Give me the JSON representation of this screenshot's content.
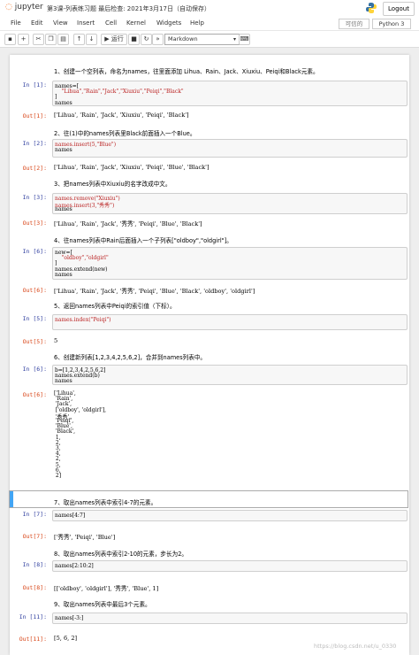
{
  "header": {
    "logo_text": "jupyter",
    "notebook_title": "第3课-列表练习题 最后检查: 2021年3月17日（自动保存）",
    "logout_label": "Logout"
  },
  "menubar": {
    "items": [
      "File",
      "Edit",
      "View",
      "Insert",
      "Cell",
      "Kernel",
      "Widgets",
      "Help"
    ],
    "trusted_label": "可信的",
    "kernel_label": "Python 3"
  },
  "toolbar": {
    "run_label": "▶ 运行",
    "cell_type": "Markdown"
  },
  "cells": [
    {
      "md": "1、创建一个空列表，命名为names，往里面添加 Lihua、Rain、Jack、Xiuxiu、Peiqi和Black元素。",
      "in_prompt": "In  [1]:",
      "code": [
        "names=[",
        "    \"Lihua\",\"Rain\",\"Jack\",\"Xiuxiu\",\"Peiqi\",\"Black\"",
        "]",
        "names"
      ],
      "out_prompt": "Out[1]:",
      "output": [
        "['Lihua', 'Rain', 'Jack', 'Xiuxiu', 'Peiqi', 'Black']"
      ]
    },
    {
      "md": "2、往(1)中的names列表里Black前面插入一个Blue。",
      "in_prompt": "In  [2]:",
      "code": [
        "names.insert(5,\"Blue\")",
        "names"
      ],
      "out_prompt": "Out[2]:",
      "output": [
        "['Lihua', 'Rain', 'Jack', 'Xiuxiu', 'Peiqi', 'Blue', 'Black']"
      ]
    },
    {
      "md": "3、把names列表中Xiuxiu的名字改成中文。",
      "in_prompt": "In  [3]:",
      "code": [
        "names.remove(\"Xiuxiu\")",
        "names.insert(3,\"秀秀\")",
        "names"
      ],
      "out_prompt": "Out[3]:",
      "output": [
        "['Lihua', 'Rain', 'Jack', '秀秀', 'Peiqi', 'Blue', 'Black']"
      ]
    },
    {
      "md": "4、往names列表中Rain后面插入一个子列表[\"oldboy\",\"oldgirl\"]。",
      "in_prompt": "In  [6]:",
      "code": [
        "new=[",
        "    \"oldboy\",\"oldgirl\"",
        "]",
        "names.extend(new)",
        "names"
      ],
      "out_prompt": "Out[6]:",
      "output": [
        "['Lihua', 'Rain', 'Jack', '秀秀', 'Peiqi', 'Blue', 'Black', 'oldboy', 'oldgirl']"
      ]
    },
    {
      "md": "5、返回names列表中Peiqi的索引值（下标）。",
      "in_prompt": "In  [5]:",
      "code": [
        "names.index(\"Peiqi\")"
      ],
      "out_prompt": "Out[5]:",
      "output": [
        "5"
      ]
    },
    {
      "md": "6、创建新列表[1,2,3,4,2,5,6,2]，合并到names列表中。",
      "in_prompt": "In  [6]:",
      "code": [
        "b=[1,2,3,4,2,5,6,2]",
        "names.extend(b)",
        "names"
      ],
      "out_prompt": "Out[6]:",
      "output": [
        "['Lihua',",
        " 'Rain',",
        " 'Jack',",
        " ['oldboy', 'oldgirl'],",
        " '秀秀',",
        " 'Peiqi',",
        " 'Blue',",
        " 'Black',",
        " 1,",
        " 2,",
        " 3,",
        " 4,",
        " 2,",
        " 5,",
        " 6,",
        " 2]"
      ]
    },
    {
      "md": "7、取出names列表中索引4-7的元素。",
      "in_prompt": "In  [7]:",
      "code": [
        "names[4:7]"
      ],
      "out_prompt": "Out[7]:",
      "output": [
        "['秀秀', 'Peiqi', 'Blue']"
      ]
    },
    {
      "md": "8、取出names列表中索引2-10的元素，步长为2。",
      "in_prompt": "In  [8]:",
      "code": [
        "names[2:10:2]"
      ],
      "out_prompt": "Out[8]:",
      "output": [
        "[['oldboy', 'oldgirl'], '秀秀', 'Blue', 1]"
      ]
    },
    {
      "md": "9、取出names列表中最后3个元素。",
      "in_prompt": "In  [11]:",
      "code": [
        "names[-3:]"
      ],
      "out_prompt": "Out[11]:",
      "output": [
        "[5, 6, 2]"
      ]
    }
  ],
  "watermark": "https://blog.csdn.net/u_0330"
}
